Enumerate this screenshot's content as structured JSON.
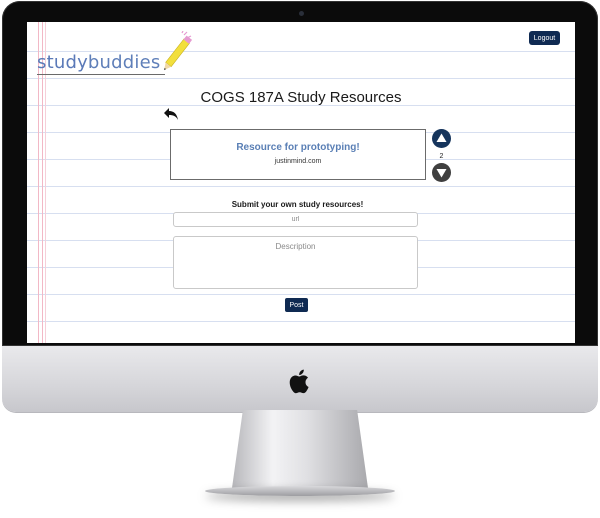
{
  "header": {
    "logo_text_a": "study",
    "logo_text_b": "buddies",
    "logout_label": "Logout"
  },
  "page": {
    "title": "COGS 187A Study Resources"
  },
  "resource": {
    "title": "Resource for prototyping!",
    "url": "justinmind.com",
    "vote_count": "2"
  },
  "submit": {
    "heading": "Submit your own study resources!",
    "url_placeholder": "url",
    "description_placeholder": "Description",
    "post_label": "Post"
  },
  "icons": {
    "back": "back-arrow-icon",
    "upvote": "upvote-icon",
    "downvote": "downvote-icon",
    "pencil": "pencil-icon",
    "apple": "apple-logo-icon"
  },
  "colors": {
    "brand_navy": "#0f2a52",
    "resource_title": "#5a7fb5",
    "downvote_gray": "#3f3f3f",
    "notebook_line": "#d7dff0",
    "margin_pink": "#f2b8c6"
  }
}
